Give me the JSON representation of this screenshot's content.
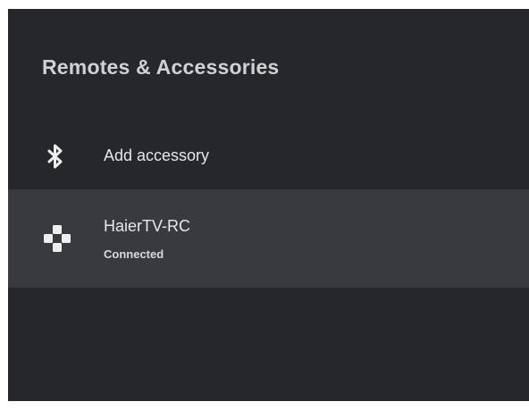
{
  "page": {
    "title": "Remotes & Accessories"
  },
  "rows": [
    {
      "label": "Add accessory",
      "icon": "bluetooth-icon"
    },
    {
      "label": "HaierTV-RC",
      "status": "Connected",
      "icon": "gamepad-icon"
    }
  ],
  "colors": {
    "background": "#25272b",
    "selected_row": "#383a3e",
    "title_text": "#cfd1d3",
    "row_text": "#e6e7e9"
  }
}
